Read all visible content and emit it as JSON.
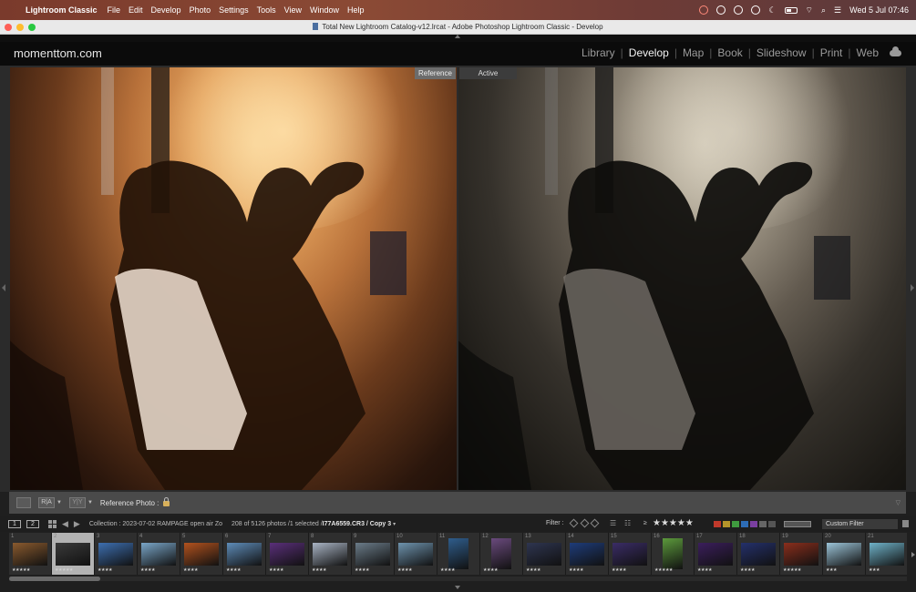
{
  "menubar": {
    "app": "Lightroom Classic",
    "items": [
      "File",
      "Edit",
      "Develop",
      "Photo",
      "Settings",
      "Tools",
      "View",
      "Window",
      "Help"
    ],
    "clock": "Wed 5 Jul  07:46"
  },
  "window": {
    "title": "Total New Lightroom Catalog-v12.lrcat - Adobe Photoshop Lightroom Classic - Develop"
  },
  "identity": {
    "brand": "momenttom.com"
  },
  "modules": {
    "items": [
      "Library",
      "Develop",
      "Map",
      "Book",
      "Slideshow",
      "Print",
      "Web"
    ],
    "active": "Develop"
  },
  "compare": {
    "reference_label": "Reference",
    "active_label": "Active"
  },
  "toolbar": {
    "view_ry": "R|A",
    "view_yy": "Y|Y",
    "reference_photo_label": "Reference Photo :"
  },
  "filmstrip_header": {
    "monitor1": "1",
    "monitor2": "2",
    "collection": "Collection : 2023-07-02 RAMPAGE open air Zo",
    "count": "208 of 5126 photos /1 selected /",
    "filename": "I77A6559.CR3 / Copy 3",
    "filter_label": "Filter :",
    "stars": "★★★★★",
    "star_prefix": "≥",
    "custom_filter": "Custom Filter",
    "label_colors": [
      "#c0392b",
      "#d4a017",
      "#3f9a3f",
      "#2d6cb5",
      "#7a3fa0",
      "#666666",
      "#555555"
    ]
  },
  "filmstrip": {
    "cells": [
      {
        "num": "1",
        "rating": "★★★★★",
        "color": "#8a5a2e",
        "selected": false,
        "current": false,
        "portrait": false
      },
      {
        "num": "2",
        "rating": "★★★★★",
        "color": "#3a3a3a",
        "selected": true,
        "current": true,
        "portrait": false
      },
      {
        "num": "3",
        "rating": "★★★★",
        "color": "#3d6fb0",
        "selected": false,
        "current": false,
        "portrait": false
      },
      {
        "num": "4",
        "rating": "★★★★",
        "color": "#7aa6c8",
        "selected": false,
        "current": false,
        "portrait": false
      },
      {
        "num": "5",
        "rating": "★★★★",
        "color": "#b2521e",
        "selected": false,
        "current": false,
        "portrait": false
      },
      {
        "num": "6",
        "rating": "★★★★",
        "color": "#5e8cb8",
        "selected": false,
        "current": false,
        "portrait": false
      },
      {
        "num": "7",
        "rating": "★★★★",
        "color": "#5a2f7a",
        "selected": false,
        "current": false,
        "portrait": false
      },
      {
        "num": "8",
        "rating": "★★★★",
        "color": "#a9b4c4",
        "selected": false,
        "current": false,
        "portrait": false
      },
      {
        "num": "9",
        "rating": "★★★★",
        "color": "#6b7c89",
        "selected": false,
        "current": false,
        "portrait": false
      },
      {
        "num": "10",
        "rating": "★★★★",
        "color": "#6e93ad",
        "selected": false,
        "current": false,
        "portrait": false
      },
      {
        "num": "11",
        "rating": "★★★★",
        "color": "#2f5d8c",
        "selected": false,
        "current": false,
        "portrait": true
      },
      {
        "num": "12",
        "rating": "★★★★",
        "color": "#6a4a7d",
        "selected": false,
        "current": false,
        "portrait": true
      },
      {
        "num": "13",
        "rating": "★★★★",
        "color": "#2e3550",
        "selected": false,
        "current": false,
        "portrait": false
      },
      {
        "num": "14",
        "rating": "★★★★",
        "color": "#1e3c7a",
        "selected": false,
        "current": false,
        "portrait": false
      },
      {
        "num": "15",
        "rating": "★★★★",
        "color": "#3a2c66",
        "selected": false,
        "current": false,
        "portrait": false
      },
      {
        "num": "16",
        "rating": "★★★★★",
        "color": "#5c9a3c",
        "selected": false,
        "current": false,
        "portrait": true
      },
      {
        "num": "17",
        "rating": "★★★★",
        "color": "#3b1e5c",
        "selected": false,
        "current": false,
        "portrait": false
      },
      {
        "num": "18",
        "rating": "★★★★",
        "color": "#24306b",
        "selected": false,
        "current": false,
        "portrait": false
      },
      {
        "num": "19",
        "rating": "★★★★★",
        "color": "#8a2e1c",
        "selected": false,
        "current": false,
        "portrait": false
      },
      {
        "num": "20",
        "rating": "★★★",
        "color": "#9cc4d8",
        "selected": false,
        "current": false,
        "portrait": false
      },
      {
        "num": "21",
        "rating": "★★★",
        "color": "#6fb2c8",
        "selected": false,
        "current": false,
        "portrait": false
      }
    ]
  }
}
